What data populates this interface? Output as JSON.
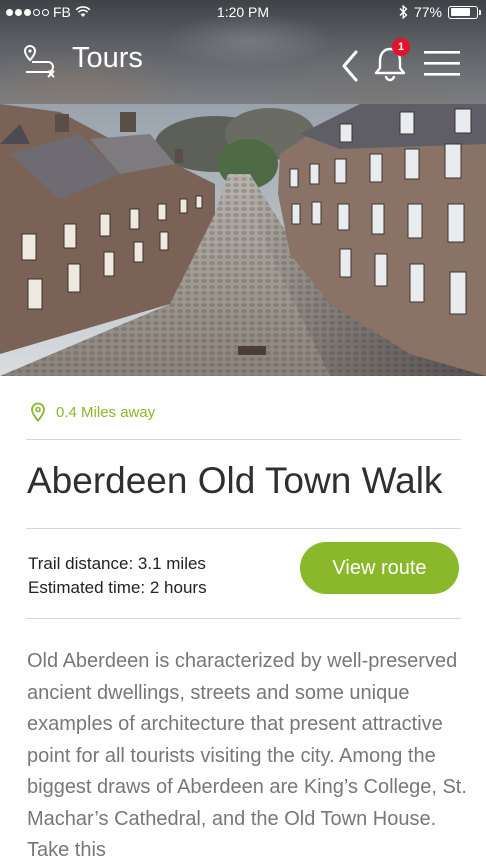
{
  "status_bar": {
    "carrier": "FB",
    "time": "1:20 PM",
    "battery": "77%",
    "battery_level": 0.77,
    "signal_bars_filled": 3,
    "signal_bars_total": 5
  },
  "app_bar": {
    "title": "Tours",
    "notification_count": "1"
  },
  "tour": {
    "distance_away": "0.4 Miles away",
    "title": "Aberdeen Old Town Walk",
    "trail_distance": "Trail distance: 3.1 miles",
    "estimated_time": "Estimated time: 2 hours",
    "view_route_label": "View route",
    "description": "Old Aberdeen is characterized by well-preserved ancient dwellings, streets and some unique examples of architecture that present attractive point for all tourists visiting the city. Among the biggest draws of Aberdeen are King’s College, St. Machar’s Cathedral, and the Old Town House. Take this"
  },
  "colors": {
    "accent": "#8ab82b",
    "badge": "#e2142c",
    "title_text": "#2f2f2f",
    "body_text": "#777777"
  },
  "icons": {
    "route": "route-map-icon",
    "back": "chevron-left-icon",
    "notifications": "bell-icon",
    "menu": "hamburger-menu-icon",
    "location": "location-pin-icon"
  }
}
